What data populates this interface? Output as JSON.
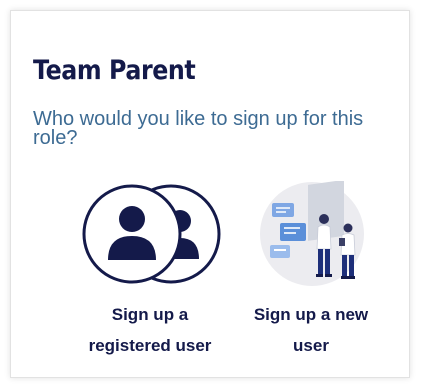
{
  "role": {
    "title": "Team Parent",
    "question": "Who would you like to sign up for this role?"
  },
  "options": [
    {
      "label": "Sign up a registered user",
      "icon": "registered-users-icon"
    },
    {
      "label": "Sign up a new user",
      "icon": "new-user-illustration"
    }
  ],
  "colors": {
    "title": "#141a4a",
    "question": "#3d6b93",
    "icon_navy": "#141a4a",
    "illustration_bg": "#ececf0",
    "illustration_blue": "#5b8fd9"
  }
}
